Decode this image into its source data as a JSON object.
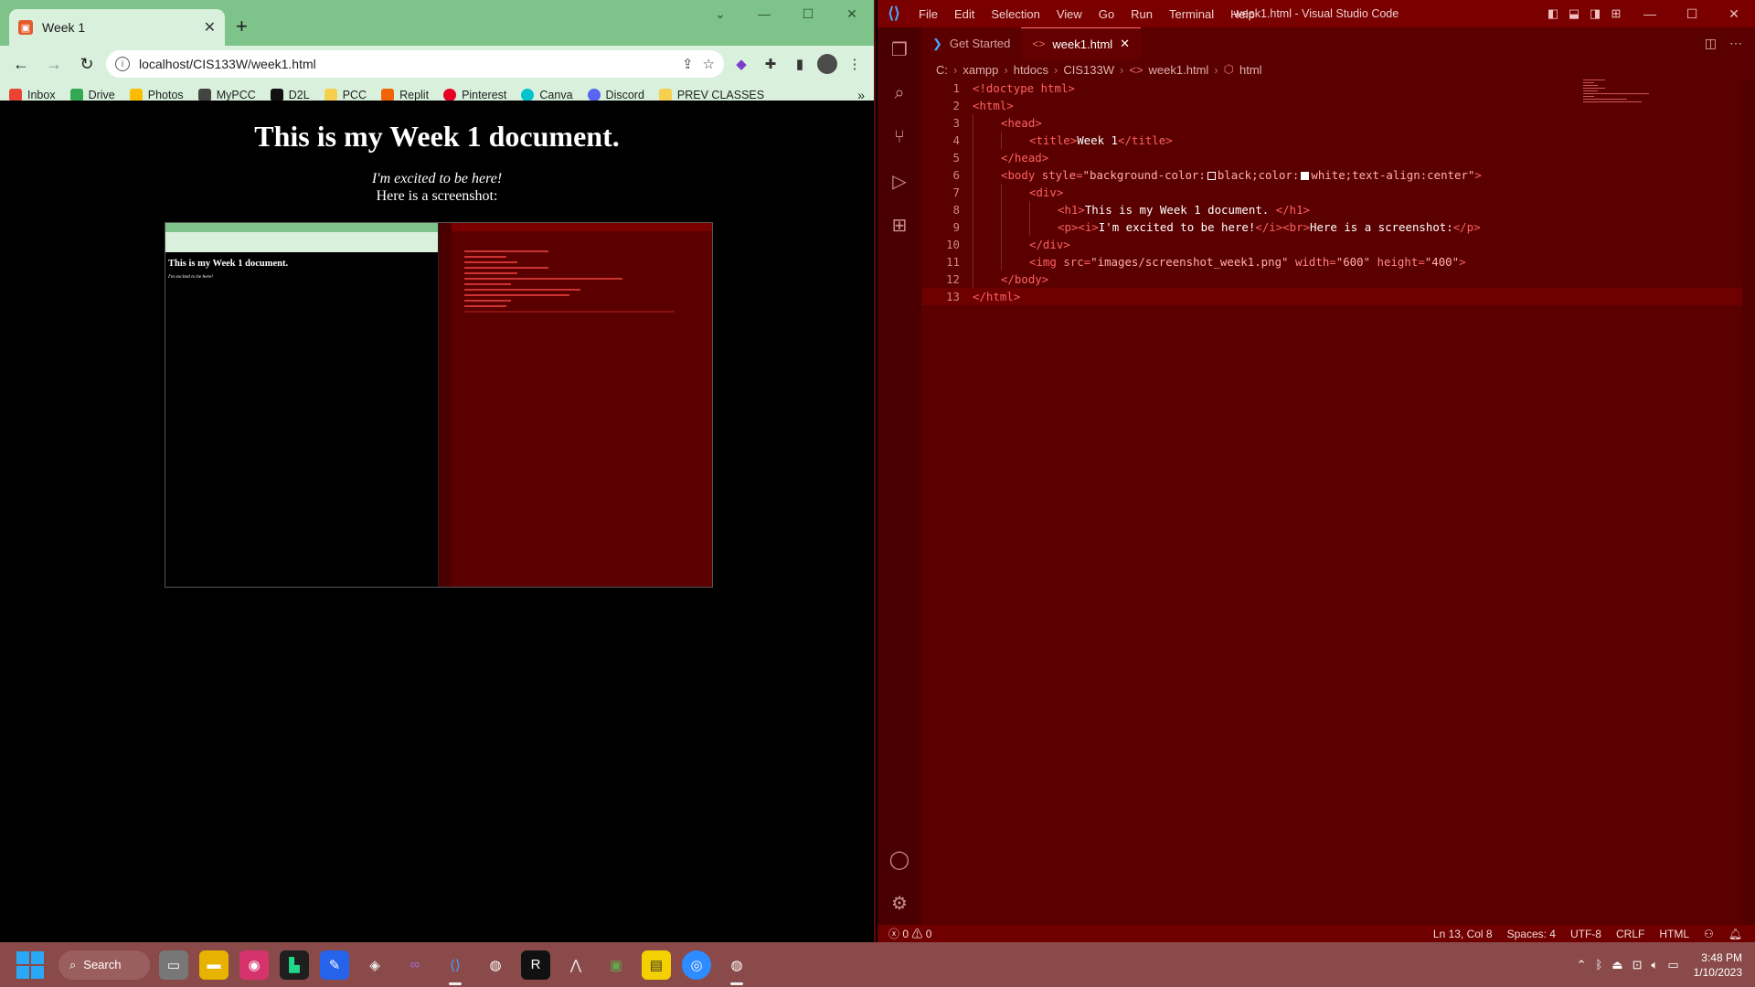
{
  "chrome": {
    "tab_title": "Week 1",
    "url": "localhost/CIS133W/week1.html",
    "bookmarks": [
      "Inbox",
      "Drive",
      "Photos",
      "MyPCC",
      "D2L",
      "PCC",
      "Replit",
      "Pinterest",
      "Canva",
      "Discord",
      "PREV CLASSES"
    ],
    "page": {
      "heading": "This is my Week 1 document.",
      "italic_line": "I'm excited to be here!",
      "line2": "Here is a screenshot:",
      "embedded_heading": "This is my Week 1 document.",
      "embedded_line": "I'm excited to be here!"
    }
  },
  "vscode": {
    "menu": [
      "File",
      "Edit",
      "Selection",
      "View",
      "Go",
      "Run",
      "Terminal",
      "Help"
    ],
    "window_title": "week1.html - Visual Studio Code",
    "tabs": [
      {
        "label": "Get Started"
      },
      {
        "label": "week1.html"
      }
    ],
    "breadcrumb": [
      "C:",
      "xampp",
      "htdocs",
      "CIS133W",
      "week1.html",
      "html"
    ],
    "code_lines": [
      "<!doctype html>",
      "<html>",
      "<head>",
      "<title>Week 1</title>",
      "</head>",
      "<body style=\"background-color:black;color:white;text-align:center\">",
      "<div>",
      "<h1>This is my Week 1 document. </h1>",
      "<p><i>I'm excited to be here!</i><br>Here is a screenshot:</p>",
      "</div>",
      "<img src=\"images/screenshot_week1.png\" width=\"600\" height=\"400\">",
      "</body>",
      "</html>"
    ],
    "line_numbers": [
      "1",
      "2",
      "3",
      "4",
      "5",
      "6",
      "7",
      "8",
      "9",
      "10",
      "11",
      "12",
      "13"
    ],
    "status": {
      "errors": "0",
      "warnings": "0",
      "position": "Ln 13, Col 8",
      "spaces": "Spaces: 4",
      "encoding": "UTF-8",
      "eol": "CRLF",
      "language": "HTML"
    }
  },
  "taskbar": {
    "search_label": "Search",
    "time": "3:48 PM",
    "date": "1/10/2023"
  }
}
